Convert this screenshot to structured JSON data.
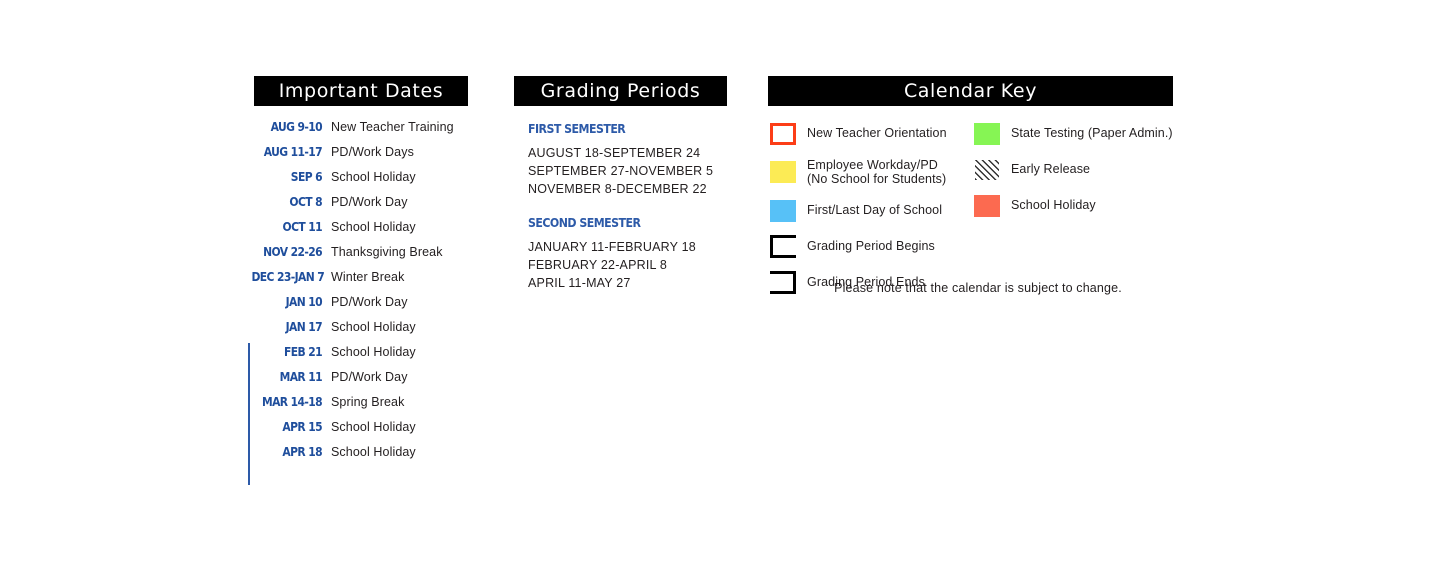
{
  "important_dates": {
    "heading": "Important Dates",
    "rows": [
      {
        "when": "AUG 9-10",
        "what": "New Teacher Training"
      },
      {
        "when": "AUG 11-17",
        "what": "PD/Work Days"
      },
      {
        "when": "SEP 6",
        "what": "School Holiday"
      },
      {
        "when": "OCT 8",
        "what": "PD/Work Day"
      },
      {
        "when": "OCT 11",
        "what": "School Holiday"
      },
      {
        "when": "NOV 22-26",
        "what": "Thanksgiving Break"
      },
      {
        "when": "DEC 23-JAN 7",
        "what": "Winter Break"
      },
      {
        "when": "JAN 10",
        "what": "PD/Work Day"
      },
      {
        "when": "JAN 17",
        "what": "School Holiday"
      },
      {
        "when": "FEB 21",
        "what": "School Holiday"
      },
      {
        "when": "MAR 11",
        "what": "PD/Work Day"
      },
      {
        "when": "MAR 14-18",
        "what": "Spring Break"
      },
      {
        "when": "APR 15",
        "what": "School Holiday"
      },
      {
        "when": "APR 18",
        "what": "School Holiday"
      }
    ]
  },
  "grading_periods": {
    "heading": "Grading Periods",
    "semesters": [
      {
        "title": "FIRST SEMESTER",
        "ranges": [
          "AUGUST 18-SEPTEMBER 24",
          "SEPTEMBER 27-NOVEMBER 5",
          "NOVEMBER 8-DECEMBER 22"
        ]
      },
      {
        "title": "SECOND SEMESTER",
        "ranges": [
          "JANUARY 11-FEBRUARY 18",
          "FEBRUARY 22-APRIL 8",
          "APRIL 11-MAY 27"
        ]
      }
    ]
  },
  "calendar_key": {
    "heading": "Calendar Key",
    "left_items": [
      {
        "label": "New Teacher Orientation",
        "label_line2": "",
        "swatch": "outline-red",
        "color": "#FC3D17"
      },
      {
        "label": "Employee Workday/PD",
        "label_line2": "(No School for Students)",
        "swatch": "yellow",
        "color": "#FCEB55"
      },
      {
        "label": "First/Last Day of School",
        "label_line2": "",
        "swatch": "blue",
        "color": "#57C1F7"
      },
      {
        "label": "Grading Period Begins",
        "label_line2": "",
        "swatch": "bracket-begin",
        "color": "#000000"
      },
      {
        "label": "Grading Period Ends",
        "label_line2": "",
        "swatch": "bracket-end",
        "color": "#000000"
      }
    ],
    "right_items": [
      {
        "label": "State Testing (Paper Admin.)",
        "label_line2": "",
        "swatch": "green",
        "color": "#86F554"
      },
      {
        "label": "Early Release",
        "label_line2": "",
        "swatch": "hatch",
        "color": "#333333"
      },
      {
        "label": "School Holiday",
        "label_line2": "",
        "swatch": "salmon",
        "color": "#FC6A50"
      }
    ],
    "disclaimer": "Please note that the calendar is subject to change."
  }
}
